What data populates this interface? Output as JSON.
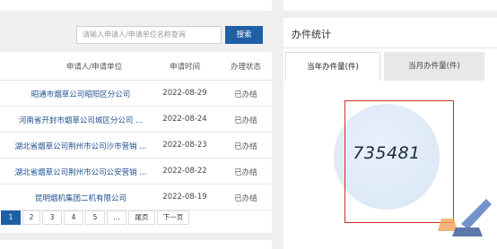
{
  "search": {
    "placeholder": "请输入申请人/申请单位名称查询",
    "button_label": "搜索"
  },
  "table": {
    "headers": [
      "申请人/申请单位",
      "申请时间",
      "办理状态"
    ],
    "rows": [
      {
        "applicant": "昭通市烟草公司昭阳区分公司",
        "date": "2022-08-29",
        "status": "已办结"
      },
      {
        "applicant": "河南省开封市烟草公司城区分公司 ...",
        "date": "2022-08-24",
        "status": "已办结"
      },
      {
        "applicant": "湖北省烟草公司荆州市公司沙市营销 ...",
        "date": "2022-08-23",
        "status": "已办结"
      },
      {
        "applicant": "湖北省烟草公司荆州市公司公安营销 ...",
        "date": "2022-08-22",
        "status": "已办结"
      },
      {
        "applicant": "昆明烟机集团二机有限公司",
        "date": "2022-08-19",
        "status": "已办结"
      }
    ]
  },
  "pager": {
    "pages": [
      "1",
      "2",
      "3",
      "4",
      "5",
      "..."
    ],
    "last_label": "尾页",
    "next_label": "下一页",
    "active": "1"
  },
  "stats": {
    "title": "办件统计",
    "tab_current_year": "当年办件量(件)",
    "tab_current_month": "当月办件量(件)",
    "count": "735481"
  },
  "colors": {
    "accent": "#1f5fa5",
    "highlight_box": "#d62b2b",
    "link": "#1f4f8f"
  }
}
